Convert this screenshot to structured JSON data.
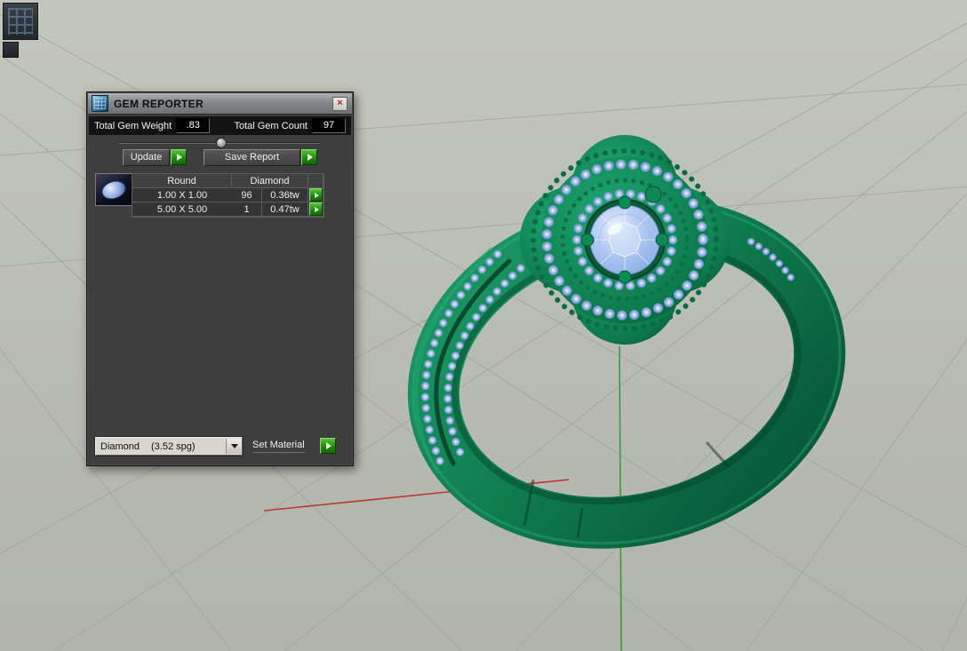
{
  "window": {
    "title": "GEM REPORTER",
    "close": "×"
  },
  "summary": {
    "weight_label": "Total Gem Weight",
    "weight_value": ".83",
    "count_label": "Total Gem Count",
    "count_value": "97"
  },
  "toolbar": {
    "update_label": "Update",
    "save_report_label": "Save Report"
  },
  "gem_table": {
    "col_size_header": "Round",
    "col_gem_header": "Diamond",
    "rows": [
      {
        "size": "1.00 X 1.00",
        "count": "96",
        "weight": "0.36tw"
      },
      {
        "size": "5.00 X 5.00",
        "count": "1",
        "weight": "0.47tw"
      }
    ]
  },
  "material_bar": {
    "dropdown_name": "Diamond",
    "dropdown_detail": "(3.52 spg)",
    "set_material_label": "Set Material"
  },
  "colors": {
    "accent_green": "#2e9a10",
    "dialog_bg": "#3e3e3e",
    "viewport_bg": "#b9bcb4",
    "ring_green": "#0d7a4c",
    "gem_blue": "#a9c3ef",
    "axis_red": "#b43a30",
    "axis_green": "#3c9a3c"
  }
}
